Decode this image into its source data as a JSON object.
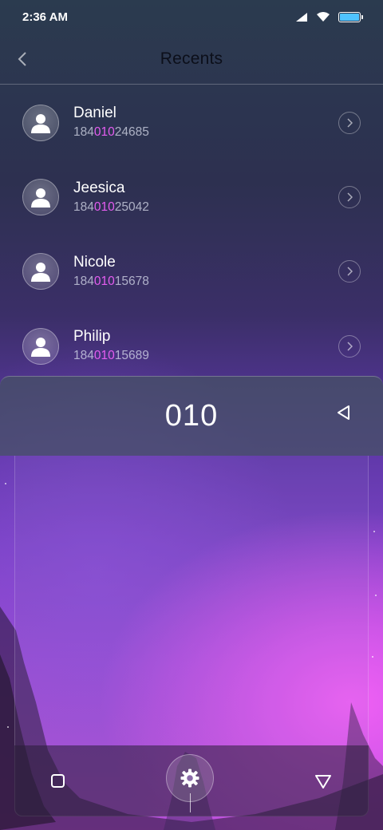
{
  "status_bar": {
    "time": "2:36 AM",
    "icons": [
      "signal-icon",
      "wifi-icon",
      "battery-icon"
    ]
  },
  "header": {
    "title": "Recents",
    "back_icon": "chevron-left-icon"
  },
  "contacts": [
    {
      "name": "Daniel",
      "number_prefix": "184",
      "number_match": "010",
      "number_suffix": "24685"
    },
    {
      "name": "Jeesica",
      "number_prefix": "184",
      "number_match": "010",
      "number_suffix": "25042"
    },
    {
      "name": "Nicole",
      "number_prefix": "184",
      "number_match": "010",
      "number_suffix": "15678"
    },
    {
      "name": "Philip",
      "number_prefix": "184",
      "number_match": "010",
      "number_suffix": "15689"
    }
  ],
  "dial": {
    "input": "010",
    "backspace_icon": "backspace-triangle-icon"
  },
  "nav": {
    "recent_apps_icon": "square-icon",
    "home_icon": "gear-icon",
    "back_icon": "triangle-down-icon"
  },
  "colors": {
    "match_highlight": "#e45df0",
    "battery": "#4fc3ff"
  }
}
